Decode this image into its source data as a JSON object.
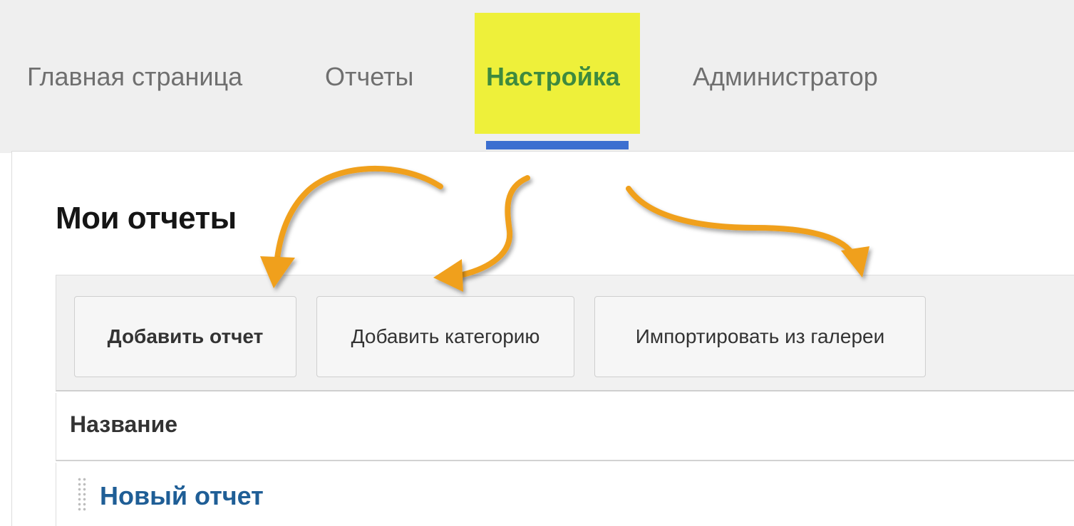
{
  "nav": {
    "tabs": [
      {
        "label": "Главная страница",
        "active": false
      },
      {
        "label": "Отчеты",
        "active": false
      },
      {
        "label": "Настройка",
        "active": true
      },
      {
        "label": "Администратор",
        "active": false
      }
    ],
    "highlight_color": "#eef03a",
    "active_text_color": "#3e8a3e",
    "underline_color": "#3c6fd0"
  },
  "main": {
    "title": "Мои отчеты"
  },
  "toolbar": {
    "buttons": [
      {
        "label": "Добавить отчет"
      },
      {
        "label": "Добавить категорию"
      },
      {
        "label": "Импортировать из галереи"
      }
    ]
  },
  "table": {
    "columns": [
      "Название"
    ],
    "rows": [
      {
        "name": "Новый отчет"
      }
    ]
  },
  "annotations": {
    "arrow_color": "#f0a01a",
    "arrow_icon": "curved-arrow-icon"
  }
}
